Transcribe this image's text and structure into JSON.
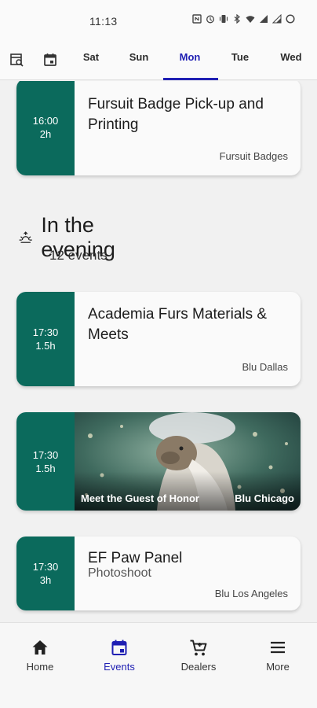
{
  "status_bar": {
    "time": "11:13"
  },
  "day_tabs": {
    "tabs": [
      {
        "label": "Sat"
      },
      {
        "label": "Sun"
      },
      {
        "label": "Mon",
        "active": true
      },
      {
        "label": "Tue"
      },
      {
        "label": "Wed"
      }
    ]
  },
  "events_top": [
    {
      "time": "16:00",
      "duration": "2h",
      "title": "Fursuit Badge Pick-up and Printing",
      "location": "Fursuit Badges"
    }
  ],
  "section": {
    "title": "In the evening",
    "count": "12 events"
  },
  "events_evening": [
    {
      "time": "17:30",
      "duration": "1.5h",
      "title": "Academia Furs Materials & Meets",
      "location": "Blu Dallas"
    },
    {
      "time": "17:30",
      "duration": "1.5h",
      "title": "Meet the Guest of Honor",
      "location": "Blu Chicago"
    },
    {
      "time": "17:30",
      "duration": "3h",
      "title": "EF Paw Panel",
      "subtitle": "Photoshoot",
      "location": "Blu Los Angeles"
    }
  ],
  "bottom_nav": {
    "items": [
      {
        "label": "Home",
        "icon": "home-icon"
      },
      {
        "label": "Events",
        "icon": "calendar-icon",
        "active": true
      },
      {
        "label": "Dealers",
        "icon": "cart-icon"
      },
      {
        "label": "More",
        "icon": "menu-icon"
      }
    ]
  },
  "colors": {
    "accent": "#1f1fb3",
    "event_time_bg": "#0b6a5c",
    "background": "#f1f1f1"
  }
}
